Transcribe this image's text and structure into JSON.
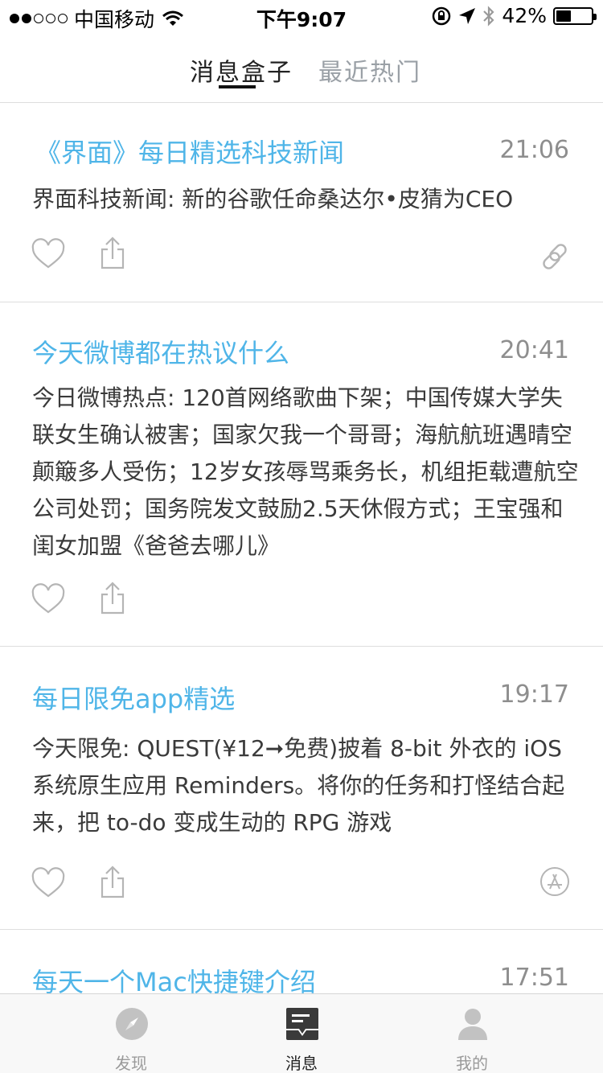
{
  "status_bar": {
    "carrier": "中国移动",
    "time": "下午9:07",
    "battery_text": "42%",
    "battery_level": 0.42
  },
  "header": {
    "tabs": [
      {
        "label": "消息盒子",
        "active": true
      },
      {
        "label": "最近热门",
        "active": false
      }
    ]
  },
  "feed": [
    {
      "title": "《界面》每日精选科技新闻",
      "time": "21:06",
      "body": "界面科技新闻: 新的谷歌任命桑达尔•皮猜为CEO",
      "actions": [
        "heart-icon",
        "share-icon",
        "link-icon"
      ]
    },
    {
      "title": "今天微博都在热议什么",
      "time": "20:41",
      "body": "今日微博热点: 120首网络歌曲下架；中国传媒大学失联女生确认被害；国家欠我一个哥哥；海航航班遇晴空颠簸多人受伤；12岁女孩辱骂乘务长，机组拒载遭航空公司处罚；国务院发文鼓励2.5天休假方式；王宝强和闺女加盟《爸爸去哪儿》",
      "actions": [
        "heart-icon",
        "share-icon"
      ]
    },
    {
      "title": "每日限免app精选",
      "time": "19:17",
      "body": "今天限免: QUEST(¥12➞免费)披着 8-bit 外衣的 iOS 系统原生应用 Reminders。将你的任务和打怪结合起来，把 to-do 变成生动的 RPG 游戏",
      "actions": [
        "heart-icon",
        "share-icon",
        "app-store-icon"
      ]
    },
    {
      "title": "每天一个Mac快捷键介绍",
      "time": "17:51"
    }
  ],
  "tabbar": {
    "items": [
      {
        "label": "发现",
        "icon": "compass-icon",
        "active": false
      },
      {
        "label": "消息",
        "icon": "message-box-icon",
        "active": true
      },
      {
        "label": "我的",
        "icon": "person-icon",
        "active": false
      }
    ]
  },
  "colors": {
    "title_blue": "#4fb5e8",
    "icon_gray": "#b5b5b5",
    "divider": "#dedede"
  }
}
